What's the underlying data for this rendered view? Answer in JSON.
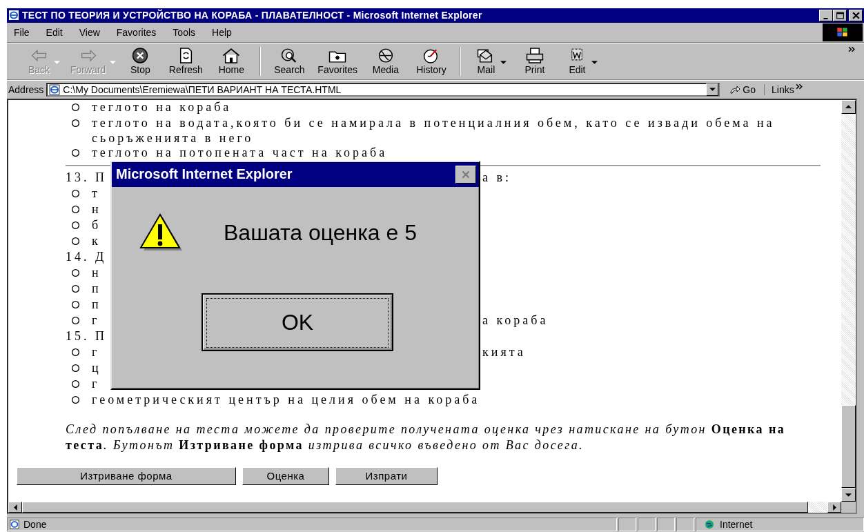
{
  "window": {
    "title": "ТЕСТ ПО ТЕОРИЯ И УСТРОЙСТВО НА КОРАБА - ПЛАВАТЕЛНОСТ - Microsoft Internet Explorer"
  },
  "menu": [
    "File",
    "Edit",
    "View",
    "Favorites",
    "Tools",
    "Help"
  ],
  "toolbar_groups": [
    [
      {
        "label": "Back",
        "kind": "back",
        "disabled": true,
        "dropdown": true
      },
      {
        "label": "Forward",
        "kind": "forward",
        "disabled": true,
        "dropdown": true
      },
      {
        "label": "Stop",
        "kind": "stop",
        "disabled": false,
        "dropdown": false
      },
      {
        "label": "Refresh",
        "kind": "refresh",
        "disabled": false,
        "dropdown": false
      },
      {
        "label": "Home",
        "kind": "home",
        "disabled": false,
        "dropdown": false
      }
    ],
    [
      {
        "label": "Search",
        "kind": "search",
        "disabled": false,
        "dropdown": false
      },
      {
        "label": "Favorites",
        "kind": "favorites",
        "disabled": false,
        "dropdown": false
      },
      {
        "label": "Media",
        "kind": "media",
        "disabled": false,
        "dropdown": false
      },
      {
        "label": "History",
        "kind": "history",
        "disabled": false,
        "dropdown": false
      }
    ],
    [
      {
        "label": "Mail",
        "kind": "mail",
        "disabled": false,
        "dropdown": true
      },
      {
        "label": "Print",
        "kind": "print",
        "disabled": false,
        "dropdown": false
      },
      {
        "label": "Edit",
        "kind": "edit",
        "disabled": false,
        "dropdown": true
      }
    ]
  ],
  "address": {
    "label": "Address",
    "value": "C:\\My Documents\\Eremiewa\\ПЕТИ ВАРИАНТ НА ТЕСТА.HTML",
    "go": "Go",
    "links": "Links"
  },
  "content": [
    {
      "kind": "option",
      "text": "теглото на кораба",
      "selected": false
    },
    {
      "kind": "option",
      "text": "теглото на водата,която би се намирала в потенциалния обем, като се извади обема на сьоръженията в него",
      "selected": false
    },
    {
      "kind": "option",
      "text": "теглото на потопената част на кораба",
      "selected": false
    },
    {
      "kind": "rule"
    },
    {
      "kind": "question",
      "text": "13. П",
      "right": "а в:"
    },
    {
      "kind": "option",
      "text": "т",
      "selected": false
    },
    {
      "kind": "option",
      "text": "н",
      "selected": false
    },
    {
      "kind": "option",
      "text": "б",
      "selected": false
    },
    {
      "kind": "option",
      "text": "к",
      "selected": false
    },
    {
      "kind": "question",
      "text": "14. Д"
    },
    {
      "kind": "option",
      "text": "н",
      "selected": false
    },
    {
      "kind": "option",
      "text": "п",
      "selected": false
    },
    {
      "kind": "option",
      "text": "п",
      "selected": false
    },
    {
      "kind": "option",
      "text": "г",
      "right": "а кораба",
      "selected": false
    },
    {
      "kind": "question",
      "text": "15. П"
    },
    {
      "kind": "option",
      "text": "г",
      "right": "кията",
      "selected": false
    },
    {
      "kind": "option",
      "text": "ц",
      "selected": false
    },
    {
      "kind": "option",
      "text": "г",
      "selected": false
    },
    {
      "kind": "option",
      "text": "геометрическият център на целия обем на кораба",
      "selected": false
    },
    {
      "kind": "note",
      "text": "*След попълване на теста можете да проверите получената оценка чрез натискане на бутон* **Оценка на теста**. *Бутонът* **Изтриване форма** *изтрива всичко въведено от Вас досега*."
    }
  ],
  "form_buttons": [
    "Изтриване форма",
    "Оценка",
    "Изпрати"
  ],
  "dialog": {
    "title": "Microsoft Internet Explorer",
    "message": "Вашата оценка е 5",
    "button": "OK"
  },
  "status_bar": {
    "text": "Done",
    "zone": "Internet"
  }
}
